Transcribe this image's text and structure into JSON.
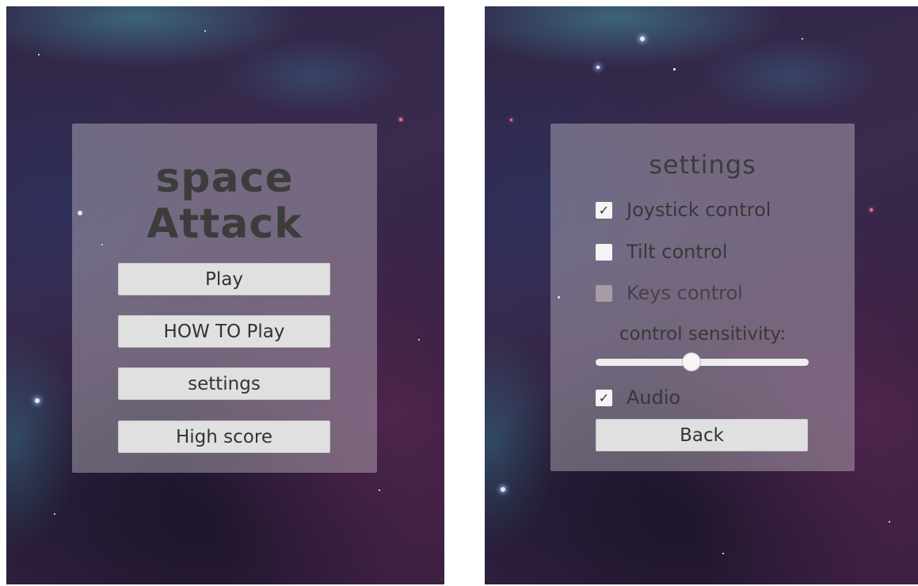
{
  "main_menu": {
    "title_line1": "space",
    "title_line2": "Attack",
    "buttons": {
      "play": "Play",
      "how_to_play": "HOW TO Play",
      "settings": "settings",
      "high_score": "High score"
    }
  },
  "settings_menu": {
    "title": "settings",
    "options": {
      "joystick": {
        "label": "Joystick control",
        "checked": true
      },
      "tilt": {
        "label": "Tilt control",
        "checked": false
      },
      "keys": {
        "label": "Keys control",
        "checked": false,
        "disabled": true
      },
      "audio": {
        "label": "Audio",
        "checked": true
      }
    },
    "sensitivity_label": "control sensitivity:",
    "sensitivity_value": 0.45,
    "back_label": "Back",
    "check_glyph": "✓"
  }
}
